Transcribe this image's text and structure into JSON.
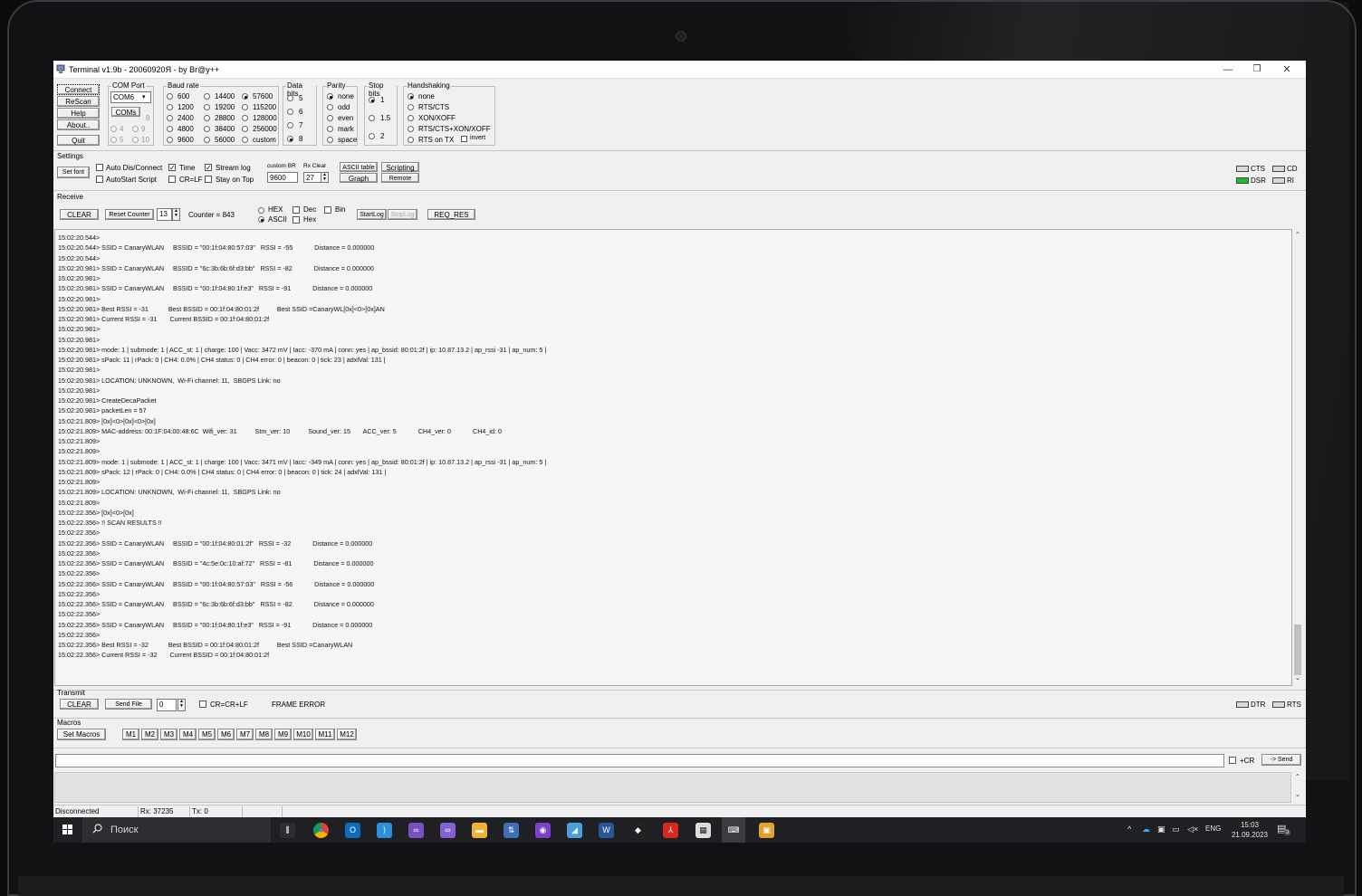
{
  "window": {
    "title": "Terminal v1.9b - 20060920Я - by Br@y++",
    "minimize": "—",
    "maximize": "❐",
    "close": "✕"
  },
  "connection": {
    "connect": "Connect",
    "rescan": "ReScan",
    "help": "Help",
    "about": "About..",
    "quit": "Quit"
  },
  "com_port": {
    "title": "COM Port",
    "selected": "COM6",
    "coms_button": "COMs",
    "grid": [
      "8",
      "4",
      "9",
      "5",
      "10"
    ]
  },
  "baud_rate": {
    "title": "Baud rate",
    "options": [
      "600",
      "1200",
      "2400",
      "4800",
      "9600",
      "14400",
      "19200",
      "28800",
      "38400",
      "56000",
      "57600",
      "115200",
      "128000",
      "256000",
      "custom"
    ],
    "selected": "57600"
  },
  "data_bits": {
    "title": "Data bits",
    "options": [
      "5",
      "6",
      "7",
      "8"
    ],
    "selected": "8"
  },
  "parity": {
    "title": "Parity",
    "options": [
      "none",
      "odd",
      "even",
      "mark",
      "space"
    ],
    "selected": "none"
  },
  "stop_bits": {
    "title": "Stop bits",
    "options": [
      "1",
      "1.5",
      "2"
    ],
    "selected": "1"
  },
  "handshaking": {
    "title": "Handshaking",
    "options": [
      "none",
      "RTS/CTS",
      "XON/XOFF",
      "RTS/CTS+XON/XOFF",
      "RTS on TX"
    ],
    "selected": "none",
    "invert_label": "invert"
  },
  "settings": {
    "title": "Settings",
    "set_font": "Set font",
    "auto_dis_connect": "Auto Dis/Connect",
    "autostart_script": "AutoStart Script",
    "time": "Time",
    "cr_lf": "CR=LF",
    "stream_log": "Stream log",
    "stay_on_top": "Stay on Top",
    "custom_br_label": "custom BR",
    "custom_br_value": "9600",
    "rx_clear_label": "Rx Clear",
    "rx_clear_value": "27",
    "ascii_table": "ASCII table",
    "graph": "Graph",
    "scripting": "Scripting",
    "remote": "Remote"
  },
  "signals": {
    "cts": "CTS",
    "cd": "CD",
    "dsr": "DSR",
    "ri": "RI",
    "dtr": "DTR",
    "rts": "RTS"
  },
  "receive": {
    "title": "Receive",
    "clear": "CLEAR",
    "reset_counter": "Reset Counter",
    "counter_field": "13",
    "counter_text": "Counter = 843",
    "hex": "HEX",
    "ascii": "ASCII",
    "dec": "Dec",
    "hex_chk": "Hex",
    "bin": "Bin",
    "startlog": "StartLog",
    "stoplog": "StopLog",
    "req_res": "REQ_RES"
  },
  "log_lines": [
    "15:02:20.544>",
    "15:02:20.544> SSID = CanaryWLAN     BSSID = \"00:1f:04:80:57:03\"   RSSI = -55            Distance = 0.000000",
    "15:02:20.544>",
    "15:02:20.981> SSID = CanaryWLAN     BSSID = \"6c:3b:6b:6f:d3:bb\"   RSSI = -82            Distance = 0.000000",
    "15:02:20.981>",
    "15:02:20.981> SSID = CanaryWLAN     BSSID = \"00:1f:04:80:1f:e3\"   RSSI = -91            Distance = 0.000000",
    "15:02:20.981>",
    "15:02:20.981> Best RSSI = -31           Best BSSID = 00:1f:04:80:01:2f          Best SSID =CanaryWL[0x]<0>[0x]AN",
    "15:02:20.981> Current RSSI = -31       Current BSSID = 00:1f:04:80:01:2f",
    "15:02:20.981>",
    "15:02:20.981>",
    "15:02:20.981> mode: 1 | submode: 1 | ACC_st: 1 | charge: 100 | Vacc: 3472 mV | Iacc: -370 mA | conn: yes | ap_bssid: 80:01:2f | ip: 10.87.13.2 | ap_rssi -31 | ap_num: 5 |",
    "15:02:20.981> sPack: 11 | rPack: 0 | CH4: 0.0% | CH4 status: 0 | CH4 error: 0 | beacon: 0 | tick: 23 | adxlVal: 131 |",
    "15:02:20.981>",
    "15:02:20.981> LOCATION: UNKNOWN,  Wi-Fi channel: 11,  SBGPS Link: no",
    "15:02:20.981>",
    "15:02:20.981> CreateDecaPacket",
    "15:02:20.981> packetLen = 57",
    "15:02:21.809> [0x]<0>[0x]<0>[0x]",
    "15:02:21.809> MAC-address: 00:1F:04:00:48:6C  Wifi_ver: 31          Stm_ver: 10          Sound_ver: 15       ACC_ver: 5            CH4_ver: 0            CH4_id: 0",
    "15:02:21.809>",
    "15:02:21.809>",
    "15:02:21.809> mode: 1 | submode: 1 | ACC_st: 1 | charge: 100 | Vacc: 3471 mV | Iacc: -349 mA | conn: yes | ap_bssid: 80:01:2f | ip: 10.87.13.2 | ap_rssi -31 | ap_num: 5 |",
    "15:02:21.809> sPack: 12 | rPack: 0 | CH4: 0.0% | CH4 status: 0 | CH4 error: 0 | beacon: 0 | tick: 24 | adxlVal: 131 |",
    "15:02:21.809>",
    "15:02:21.809> LOCATION: UNKNOWN,  Wi-Fi channel: 11,  SBGPS Link: no",
    "15:02:21.809>",
    "15:02:22.356> [0x]<0>[0x]",
    "15:02:22.356> !! SCAN RESULTS !!",
    "15:02:22.356>",
    "15:02:22.356> SSID = CanaryWLAN     BSSID = \"00:1f:04:80:01:2f\"   RSSI = -32            Distance = 0.000000",
    "15:02:22.356>",
    "15:02:22.356> SSID = CanaryWLAN     BSSID = \"4c:5e:0c:10:af:72\"   RSSI = -81            Distance = 0.000000",
    "15:02:22.356>",
    "15:02:22.356> SSID = CanaryWLAN     BSSID = \"00:1f:04:80:57:03\"   RSSI = -56            Distance = 0.000000",
    "15:02:22.356>",
    "15:02:22.356> SSID = CanaryWLAN     BSSID = \"6c:3b:6b:6f:d3:bb\"   RSSI = -82            Distance = 0.000000",
    "15:02:22.356>",
    "15:02:22.356> SSID = CanaryWLAN     BSSID = \"00:1f:04:80:1f:e3\"   RSSI = -91            Distance = 0.000000",
    "15:02:22.356>",
    "15:02:22.356> Best RSSI = -32           Best BSSID = 00:1f:04:80:01:2f          Best SSID =CanaryWLAN",
    "15:02:22.356> Current RSSI = -32       Current BSSID = 00:1f:04:80:01:2f"
  ],
  "transmit": {
    "title": "Transmit",
    "clear": "CLEAR",
    "send_file": "Send File",
    "counter_field": "0",
    "cr_crlf": "CR=CR+LF",
    "frame_error": "FRAME ERROR"
  },
  "macros": {
    "title": "Macros",
    "set_macros": "Set Macros",
    "items": [
      "M1",
      "M2",
      "M3",
      "M4",
      "M5",
      "M6",
      "M7",
      "M8",
      "M9",
      "M10",
      "M11",
      "M12"
    ]
  },
  "send": {
    "plus_cr": "+CR",
    "send_button": "-> Send",
    "input_value": ""
  },
  "status": {
    "connection": "Disconnected",
    "rx": "Rx: 37235",
    "tx": "Tx: 0"
  },
  "taskbar": {
    "search_placeholder": "Поиск",
    "language": "ENG",
    "time": "15:03",
    "date": "21.09.2023",
    "notification_count": "3",
    "apps": [
      "task-view",
      "chrome",
      "outlook",
      "vscode",
      "visual-studio",
      "visual-studio-preview",
      "file-explorer",
      "network-tool",
      "github-desktop",
      "notes",
      "word",
      "inkscape",
      "acrobat",
      "calculator",
      "terminal",
      "package"
    ]
  },
  "colors": {
    "indicator_on": "#1fbf2a",
    "taskbar": "#1f2023",
    "window_bg": "#f0f0f0"
  }
}
